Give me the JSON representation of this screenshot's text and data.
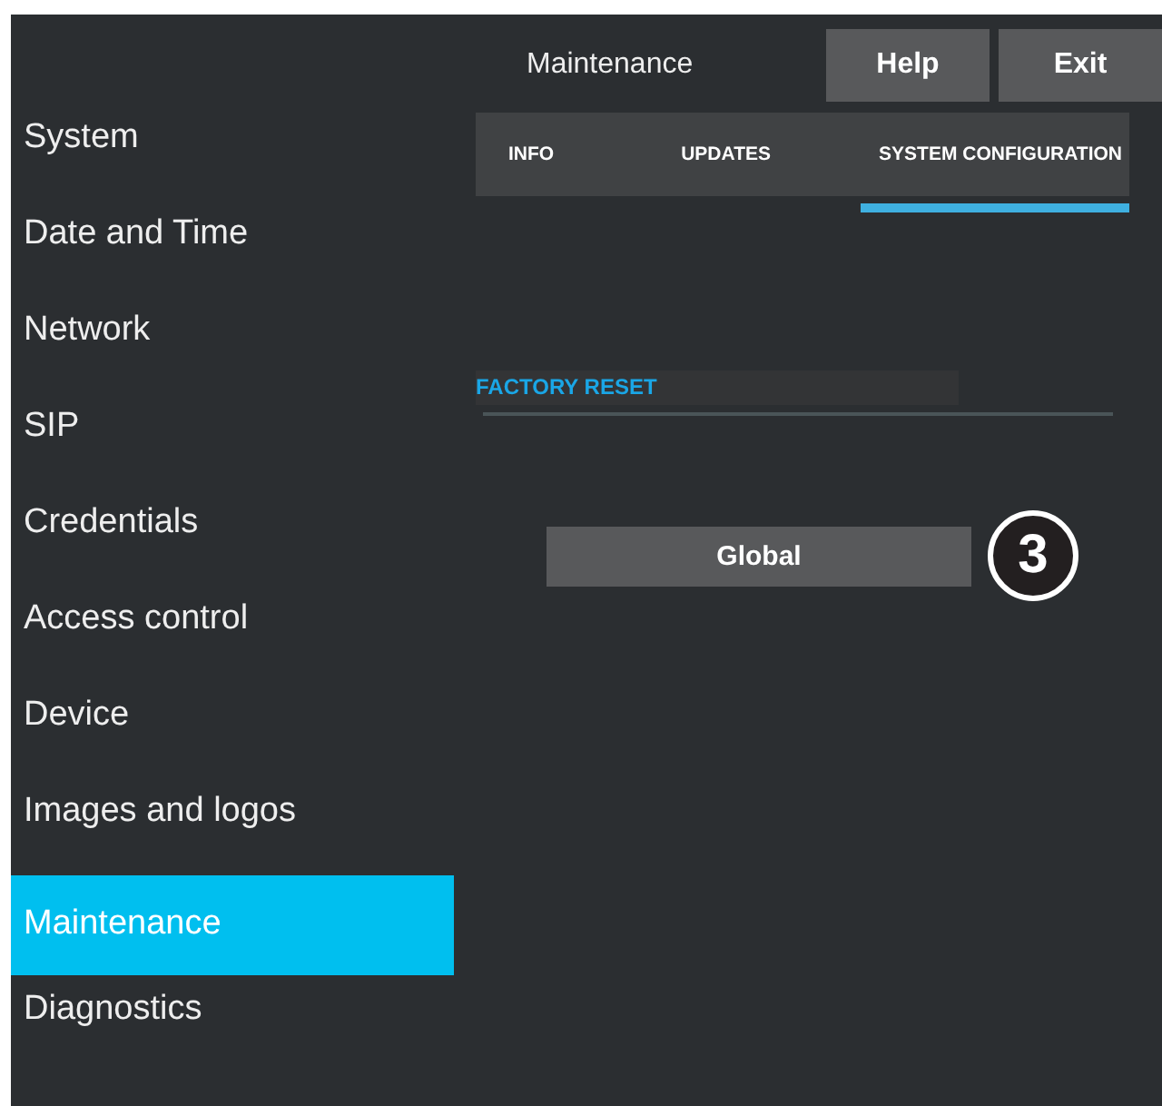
{
  "header": {
    "title": "Maintenance",
    "buttons": [
      "Help",
      "Exit"
    ]
  },
  "sidebar": {
    "items": [
      {
        "label": "System",
        "selected": false
      },
      {
        "label": "Date and Time",
        "selected": false
      },
      {
        "label": "Network",
        "selected": false
      },
      {
        "label": "SIP",
        "selected": false
      },
      {
        "label": "Credentials",
        "selected": false
      },
      {
        "label": "Access control",
        "selected": false
      },
      {
        "label": "Device",
        "selected": false
      },
      {
        "label": "Images and logos",
        "selected": false
      },
      {
        "label": "Maintenance",
        "selected": true
      },
      {
        "label": "Diagnostics",
        "selected": false
      }
    ]
  },
  "tabs": [
    {
      "label": "INFO",
      "selected": false
    },
    {
      "label": "UPDATES",
      "selected": false
    },
    {
      "label": "SYSTEM CONFIGURATION",
      "selected": true
    }
  ],
  "section": {
    "title": "FACTORY RESET",
    "button": "Global",
    "callout": "3"
  }
}
